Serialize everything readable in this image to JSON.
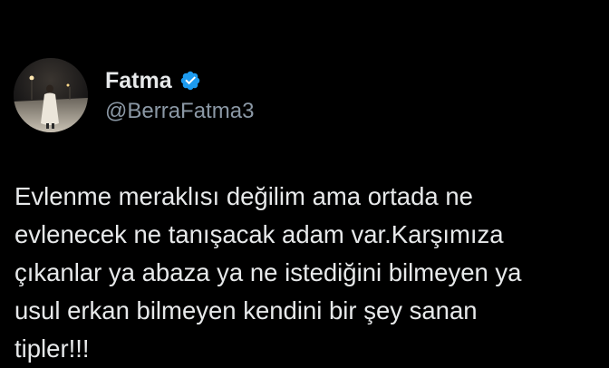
{
  "author": {
    "display_name": "Fatma",
    "handle": "@BerraFatma3",
    "verified_badge_icon": "verified-check-icon",
    "verified_color": "#1d9bf0"
  },
  "avatar": {
    "description_icon": "profile-photo"
  },
  "tweet": {
    "lines": [
      "Evlenme meraklısı değilim ama ortada ne",
      "evlenecek ne tanışacak adam var.Karşımıza",
      "çıkanlar ya abaza ya ne istediğini bilmeyen ya",
      "usul erkan bilmeyen kendini bir şey sanan",
      "tipler!!!"
    ]
  },
  "colors": {
    "background": "#000000",
    "text": "#e7e9ea",
    "secondary_text": "#8b98a5"
  }
}
